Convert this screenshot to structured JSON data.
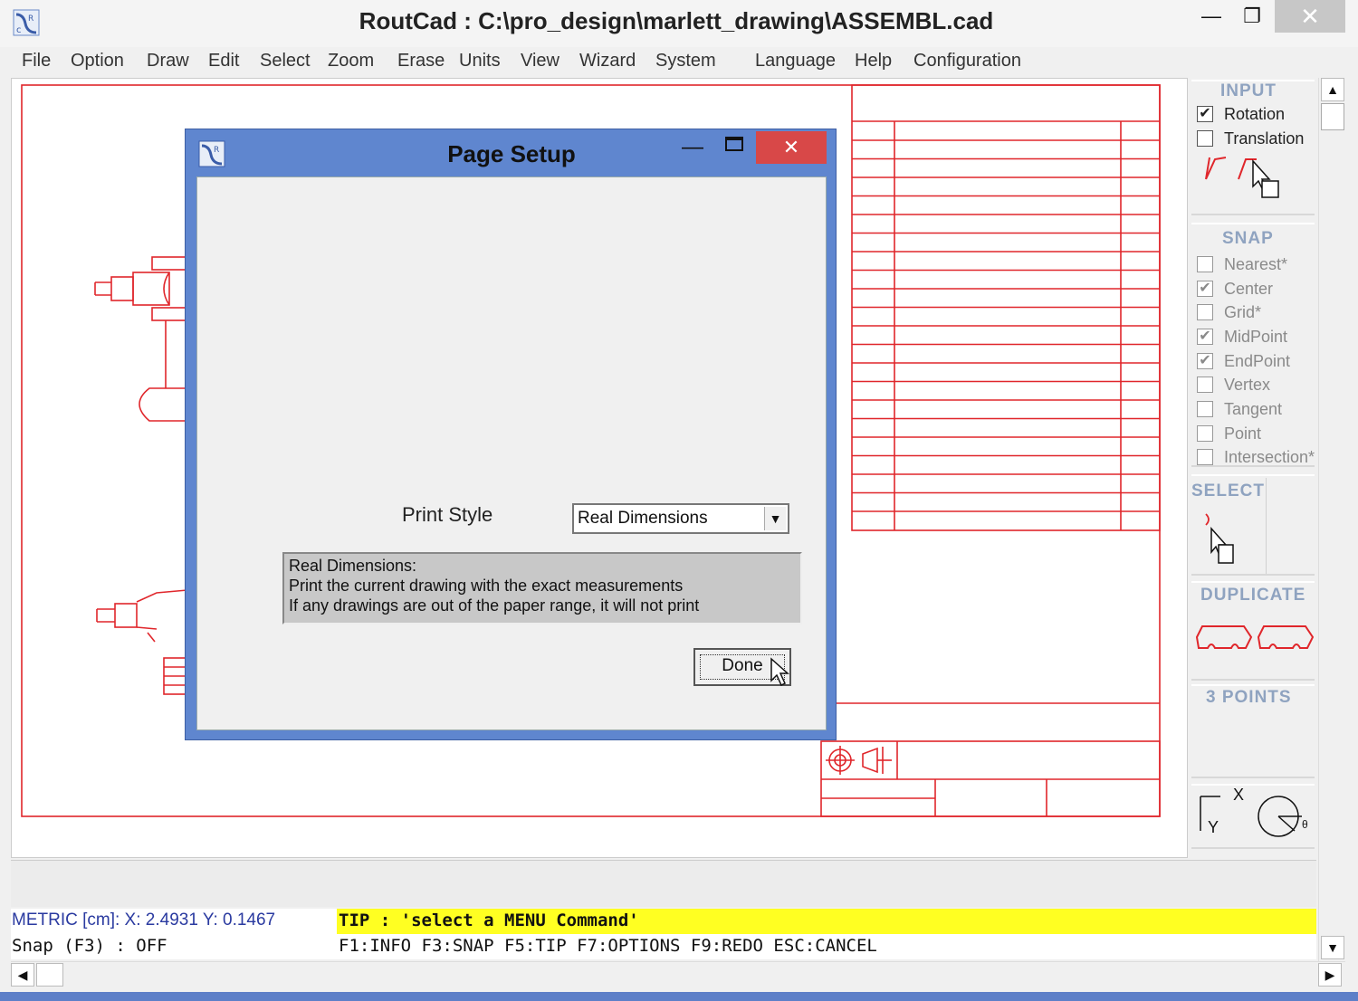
{
  "window": {
    "title": "RoutCad : C:\\pro_design\\marlett_drawing\\ASSEMBL.cad",
    "minimize_glyph": "—",
    "maximize_glyph": "❐",
    "close_glyph": "✕"
  },
  "menu": [
    "File",
    "Option",
    "Draw",
    "Edit",
    "Select",
    "Zoom",
    "Erase",
    "Units",
    "View",
    "Wizard",
    "System",
    "Language",
    "Help",
    "Configuration"
  ],
  "panel": {
    "input": {
      "title": "INPUT",
      "items": [
        {
          "label": "Rotation",
          "checked": true
        },
        {
          "label": "Translation",
          "checked": false
        }
      ]
    },
    "snap": {
      "title": "SNAP",
      "items": [
        {
          "label": "Nearest*",
          "checked": false
        },
        {
          "label": "Center",
          "checked": true
        },
        {
          "label": "Grid*",
          "checked": false
        },
        {
          "label": "MidPoint",
          "checked": true
        },
        {
          "label": "EndPoint",
          "checked": true
        },
        {
          "label": "Vertex",
          "checked": false
        },
        {
          "label": "Tangent",
          "checked": false
        },
        {
          "label": "Point",
          "checked": false
        },
        {
          "label": "Intersection*",
          "checked": false
        }
      ]
    },
    "select_title": "SELECT",
    "duplicate_title": "DUPLICATE",
    "three_points_title": "3 POINTS",
    "axis_x": "X",
    "axis_y": "Y",
    "angle_symbol": "θ"
  },
  "dialog": {
    "title": "Page Setup",
    "print_style_label": "Print Style",
    "print_style_value": "Real Dimensions",
    "description": [
      "Real Dimensions:",
      "Print the current drawing with the exact measurements",
      "If any drawings are out of the paper range, it will not print"
    ],
    "done_label": "Done"
  },
  "status": {
    "coords": "METRIC [cm]: X: 2.4931  Y: 0.1467",
    "tip": "TIP : 'select a MENU Command'",
    "snap": "Snap (F3) : OFF",
    "keys": "F1:INFO  F3:SNAP  F5:TIP  F7:OPTIONS  F9:REDO  ESC:CANCEL"
  },
  "colors": {
    "drawing": "#e0262b",
    "dialog_frame": "#5f86cf",
    "tip_bg": "#ffff22",
    "section_title": "#8fa3c0"
  }
}
